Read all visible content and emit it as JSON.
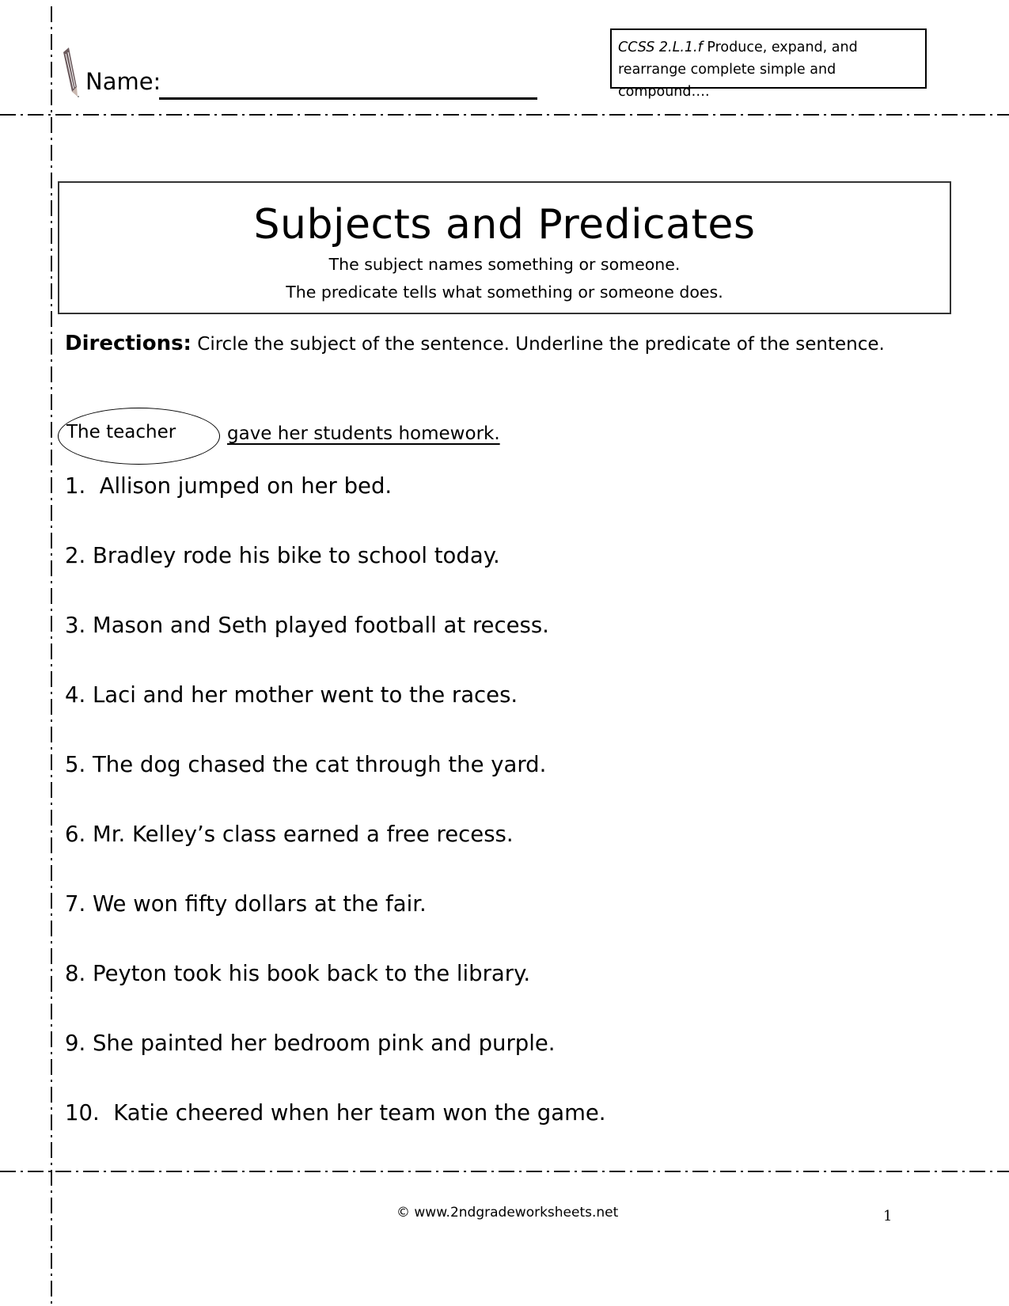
{
  "header": {
    "name_label": "Name:",
    "standard_code": "CCSS 2.L.1.f",
    "standard_text_line1": " Produce, expand, and",
    "standard_text_line2": "rearrange complete simple and compound…."
  },
  "title_box": {
    "title": "Subjects and Predicates",
    "subtitle_1": "The subject names something or someone.",
    "subtitle_2": "The predicate tells what something or someone does."
  },
  "directions": {
    "label": "Directions:",
    "text": "  Circle the subject of the sentence.  Underline the predicate of the sentence."
  },
  "example": {
    "subject": "The teacher",
    "predicate": "gave her students homework."
  },
  "items": [
    "1.  Allison jumped on her bed.",
    "2. Bradley rode his bike to school today.",
    "3. Mason and Seth played football at recess.",
    "4. Laci and her mother went to the races.",
    "5. The dog chased the cat through the yard.",
    "6. Mr. Kelley’s class earned a free recess.",
    "7. We won fifty dollars at the fair.",
    "8. Peyton took his book back to the library.",
    "9. She painted her bedroom pink and purple.",
    "10.  Katie cheered when her team won the game."
  ],
  "footer": {
    "copyright": "© www.2ndgradeworksheets.net",
    "page_number": "1"
  }
}
